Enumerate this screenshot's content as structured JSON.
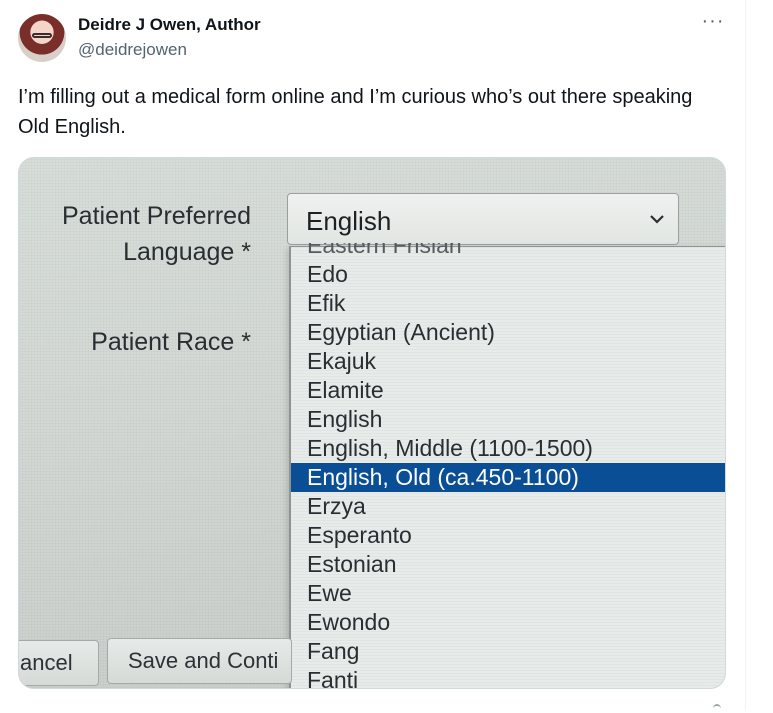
{
  "author": {
    "name": "Deidre J Owen, Author",
    "handle": "@deidrejowen"
  },
  "more_label": "···",
  "tweet_text": "I’m filling out a medical form online and I’m curious who’s out there speaking Old English.",
  "photo": {
    "labels": {
      "language_line1": "Patient Preferred",
      "language_line2": "Language *",
      "race": "Patient Race *"
    },
    "select_value": "English",
    "dropdown": {
      "options": [
        "Eastern Frisian",
        "Edo",
        "Efik",
        "Egyptian (Ancient)",
        "Ekajuk",
        "Elamite",
        "English",
        "English, Middle (1100-1500)",
        "English, Old (ca.450-1100)",
        "Erzya",
        "Esperanto",
        "Estonian",
        "Ewe",
        "Ewondo",
        "Fang",
        "Fanti"
      ],
      "highlighted": "English, Old (ca.450-1100)",
      "highlight_color": "#0a4e96"
    },
    "buttons": {
      "cancel": "ancel",
      "save": "Save and Conti"
    }
  },
  "icons": [
    "avatar",
    "more-icon",
    "chevron-down-icon"
  ]
}
